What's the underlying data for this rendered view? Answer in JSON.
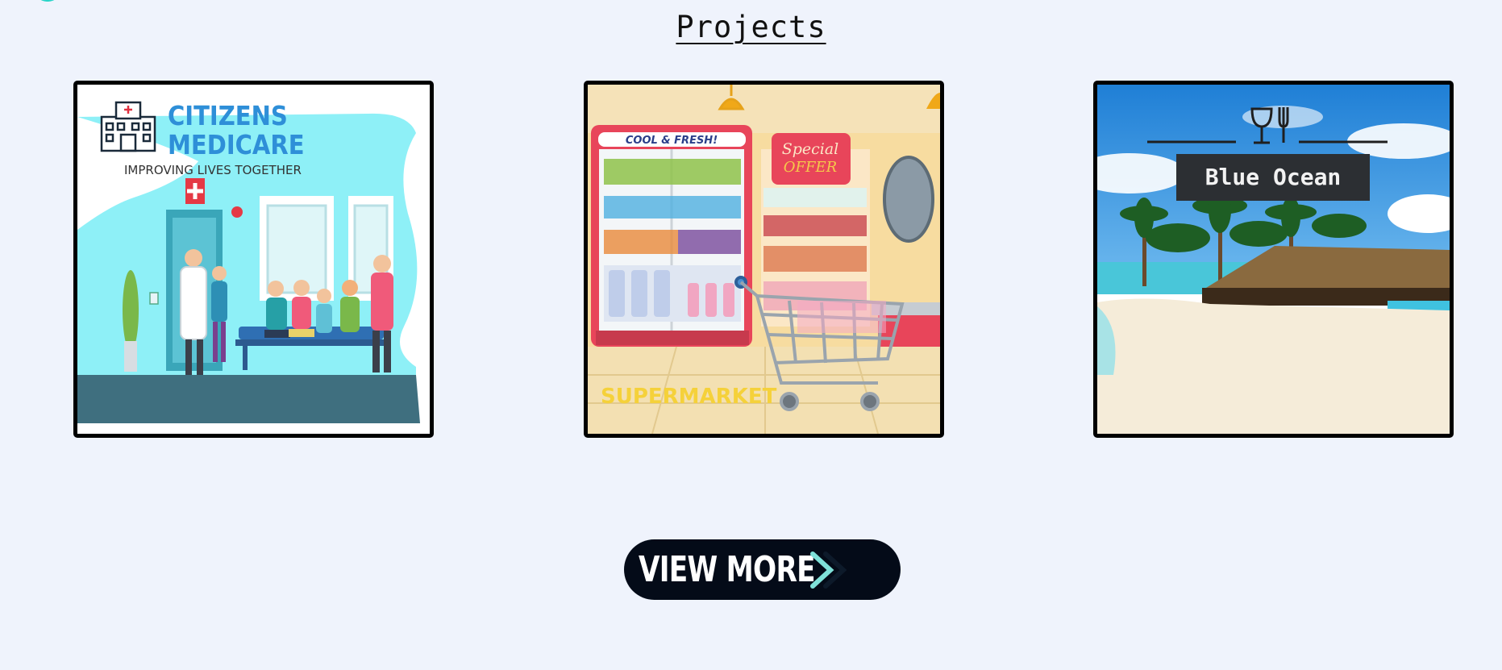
{
  "section": {
    "title": "Projects"
  },
  "projects": [
    {
      "name": "citizens-medicare",
      "logo_line1": "CITIZENS",
      "logo_line2": "MEDICARE",
      "tagline": "IMPROVING LIVES TOGETHER"
    },
    {
      "name": "supermarket",
      "fridge_sign": "COOL & FRESH!",
      "offer_line1": "Special",
      "offer_line2": "OFFER",
      "caption": "SUPERMARKET"
    },
    {
      "name": "blue-ocean",
      "sign": "Blue Ocean",
      "icon": "fork-and-glass-icon"
    }
  ],
  "cta": {
    "label": "VIEW MORE",
    "icon": "chevron-right-icon"
  },
  "colors": {
    "background": "#eff3fc",
    "button": "#040b18",
    "accent": "#2ad4c8",
    "medicare_blue": "#2e8fd8",
    "cyan": "#8ef0f7"
  }
}
